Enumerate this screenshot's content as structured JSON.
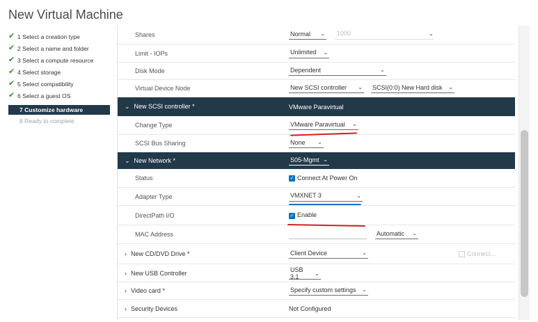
{
  "window": {
    "title": "New Virtual Machine"
  },
  "steps": [
    {
      "label": "1 Select a creation type",
      "state": "done"
    },
    {
      "label": "2 Select a name and folder",
      "state": "done"
    },
    {
      "label": "3 Select a compute resource",
      "state": "done"
    },
    {
      "label": "4 Select storage",
      "state": "done"
    },
    {
      "label": "5 Select compatibility",
      "state": "done"
    },
    {
      "label": "6 Select a guest OS",
      "state": "done"
    },
    {
      "label": "7 Customize hardware",
      "state": "active"
    },
    {
      "label": "8 Ready to complete",
      "state": "future"
    }
  ],
  "hardware": {
    "shares": {
      "label": "Shares",
      "value": "Normal",
      "number": "1000"
    },
    "limit_iops": {
      "label": "Limit - IOPs",
      "value": "Unlimited"
    },
    "disk_mode": {
      "label": "Disk Mode",
      "value": "Dependent"
    },
    "vdn": {
      "label": "Virtual Device Node",
      "controller": "New SCSI controller",
      "slot": "SCSI(0:0) New Hard disk"
    },
    "scsi_controller": {
      "label": "New SCSI controller *",
      "value": "VMware Paravirtual"
    },
    "change_type": {
      "label": "Change Type",
      "value": "VMware Paravirtual"
    },
    "bus_sharing": {
      "label": "SCSI Bus Sharing",
      "value": "None"
    },
    "network": {
      "label": "New Network *",
      "value": "S05-Mgmt"
    },
    "status": {
      "label": "Status",
      "value": "Connect At Power On"
    },
    "adapter_type": {
      "label": "Adapter Type",
      "value": "VMXNET 3"
    },
    "directpath": {
      "label": "DirectPath I/O",
      "value": "Enable"
    },
    "mac": {
      "label": "MAC Address",
      "value": "",
      "mode": "Automatic"
    },
    "cdrom": {
      "label": "New CD/DVD Drive *",
      "value": "Client Device",
      "connect": "Connect..."
    },
    "usb": {
      "label": "New USB Controller",
      "value": "USB 3.1"
    },
    "video": {
      "label": "Video card *",
      "value": "Specify custom settings"
    },
    "security": {
      "label": "Security Devices",
      "value": "Not Configured"
    }
  },
  "icons": {
    "check": "check-icon",
    "chevron": "chevron-down-icon",
    "expand": "chevron-right-icon",
    "collapse": "chevron-down-icon"
  },
  "colors": {
    "header_bg": "#22394a",
    "check_green": "#3c8b3c",
    "checkbox_blue": "#0b72c6",
    "annotation_red": "#d32020",
    "annotation_blue": "#1e6fd0"
  }
}
